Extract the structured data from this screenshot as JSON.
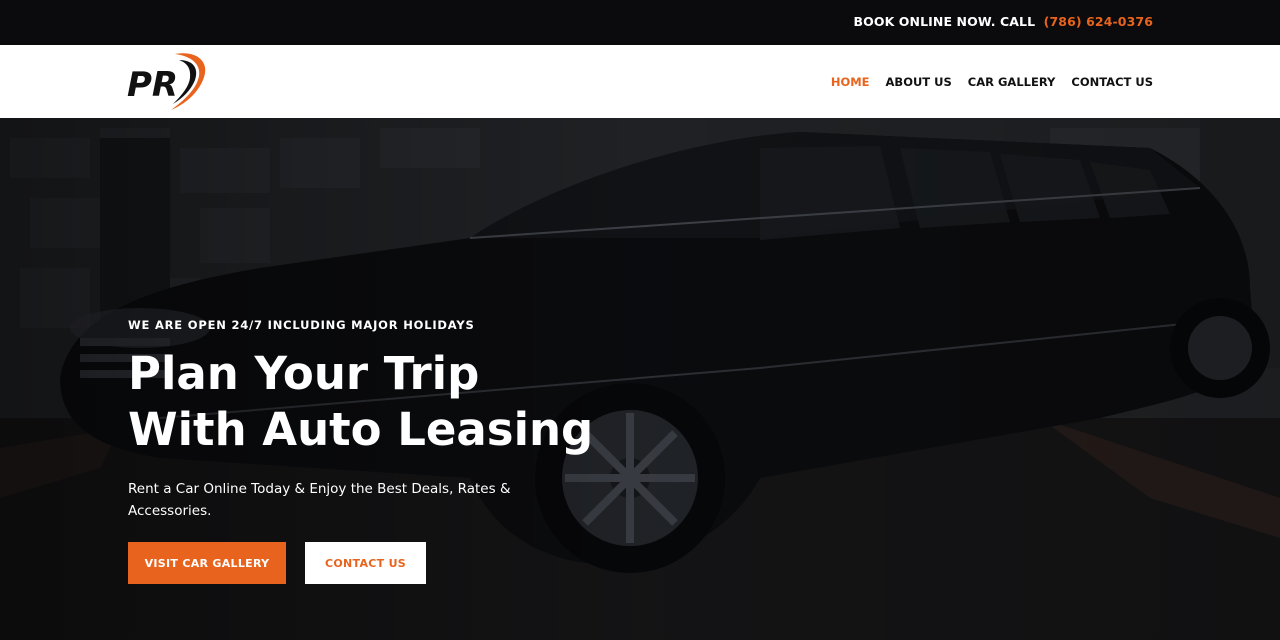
{
  "topbar": {
    "text": "BOOK ONLINE NOW. CALL",
    "phone": "(786) 624-0376"
  },
  "brand": {
    "logo_text": "PR",
    "accent": "#e8641e"
  },
  "nav": {
    "items": [
      {
        "label": "HOME",
        "active": true
      },
      {
        "label": "ABOUT US",
        "active": false
      },
      {
        "label": "CAR GALLERY",
        "active": false
      },
      {
        "label": "CONTACT US",
        "active": false
      }
    ]
  },
  "hero": {
    "kicker": "WE ARE OPEN 24/7 INCLUDING MAJOR HOLIDAYS",
    "title_line1": "Plan Your Trip",
    "title_line2": "With Auto Leasing",
    "subtitle": "Rent a Car Online Today & Enjoy the Best Deals, Rates & Accessories.",
    "primary_button": "VISIT CAR GALLERY",
    "secondary_button": "CONTACT US"
  }
}
